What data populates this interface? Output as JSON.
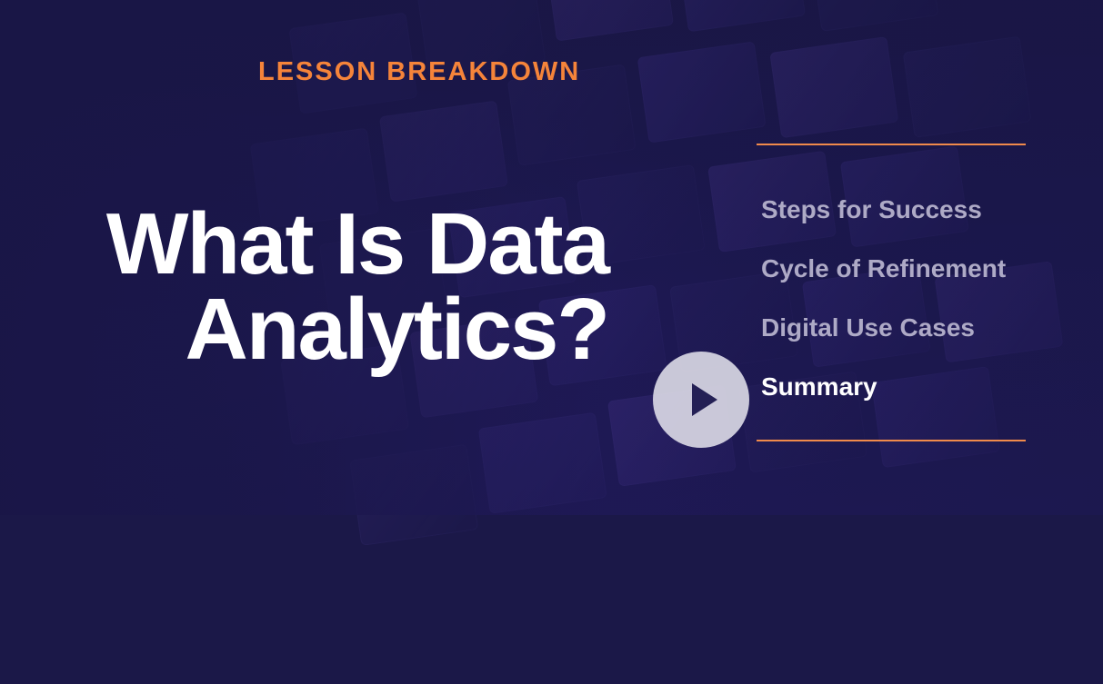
{
  "slide": {
    "eyebrow": "LESSON BREAKDOWN",
    "title_line_1": "What Is Data",
    "title_line_2": "Analytics?"
  },
  "agenda": {
    "items": [
      {
        "label": "Steps for Success",
        "active": false
      },
      {
        "label": "Cycle of Refinement",
        "active": false
      },
      {
        "label": "Digital Use Cases",
        "active": false
      },
      {
        "label": "Summary",
        "active": true
      }
    ]
  },
  "colors": {
    "background": "#1b1848",
    "accent": "#f5843a",
    "title": "#ffffff",
    "agenda_inactive": "#aeaac6",
    "agenda_active": "#ffffff"
  },
  "icons": {
    "play_button": "play-icon"
  }
}
